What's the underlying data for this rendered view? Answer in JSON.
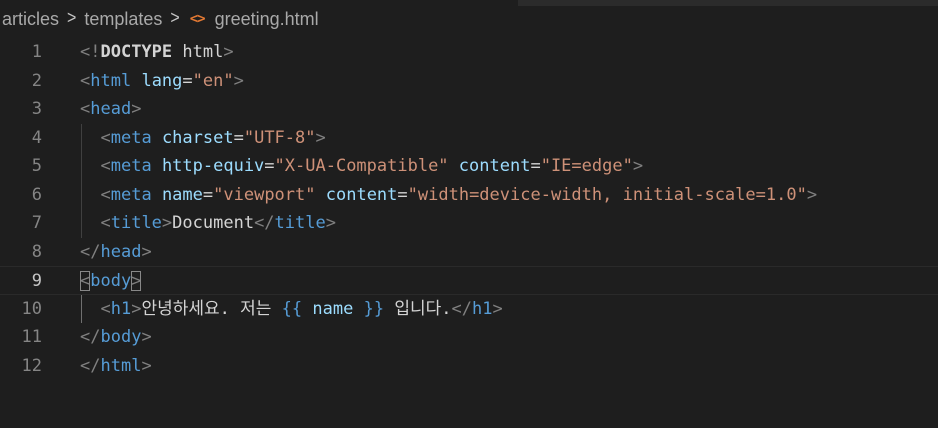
{
  "breadcrumb": {
    "items": [
      "articles",
      "templates",
      "greeting.html"
    ],
    "separator": ">",
    "file_icon": "<>"
  },
  "editor": {
    "current_line": 9,
    "lines": [
      {
        "number": "1",
        "indent": 0,
        "tokens": [
          [
            "punc",
            "<!"
          ],
          [
            "bold",
            "DOCTYPE"
          ],
          [
            "text",
            " html"
          ],
          [
            "punc",
            ">"
          ]
        ]
      },
      {
        "number": "2",
        "indent": 0,
        "tokens": [
          [
            "punc",
            "<"
          ],
          [
            "tag",
            "html"
          ],
          [
            "text",
            " "
          ],
          [
            "attr",
            "lang"
          ],
          [
            "text",
            "="
          ],
          [
            "str",
            "\"en\""
          ],
          [
            "punc",
            ">"
          ]
        ]
      },
      {
        "number": "3",
        "indent": 0,
        "tokens": [
          [
            "punc",
            "<"
          ],
          [
            "tag",
            "head"
          ],
          [
            "punc",
            ">"
          ]
        ]
      },
      {
        "number": "4",
        "indent": 1,
        "tokens": [
          [
            "text",
            "  "
          ],
          [
            "punc",
            "<"
          ],
          [
            "tag",
            "meta"
          ],
          [
            "text",
            " "
          ],
          [
            "attr",
            "charset"
          ],
          [
            "text",
            "="
          ],
          [
            "str",
            "\"UTF-8\""
          ],
          [
            "punc",
            ">"
          ]
        ]
      },
      {
        "number": "5",
        "indent": 1,
        "tokens": [
          [
            "text",
            "  "
          ],
          [
            "punc",
            "<"
          ],
          [
            "tag",
            "meta"
          ],
          [
            "text",
            " "
          ],
          [
            "attr",
            "http-equiv"
          ],
          [
            "text",
            "="
          ],
          [
            "str",
            "\"X-UA-Compatible\""
          ],
          [
            "text",
            " "
          ],
          [
            "attr",
            "content"
          ],
          [
            "text",
            "="
          ],
          [
            "str",
            "\"IE=edge\""
          ],
          [
            "punc",
            ">"
          ]
        ]
      },
      {
        "number": "6",
        "indent": 1,
        "tokens": [
          [
            "text",
            "  "
          ],
          [
            "punc",
            "<"
          ],
          [
            "tag",
            "meta"
          ],
          [
            "text",
            " "
          ],
          [
            "attr",
            "name"
          ],
          [
            "text",
            "="
          ],
          [
            "str",
            "\"viewport\""
          ],
          [
            "text",
            " "
          ],
          [
            "attr",
            "content"
          ],
          [
            "text",
            "="
          ],
          [
            "str",
            "\"width=device-width, initial-scale=1.0\""
          ],
          [
            "punc",
            ">"
          ]
        ]
      },
      {
        "number": "7",
        "indent": 1,
        "tokens": [
          [
            "text",
            "  "
          ],
          [
            "punc",
            "<"
          ],
          [
            "tag",
            "title"
          ],
          [
            "punc",
            ">"
          ],
          [
            "text",
            "Document"
          ],
          [
            "punc",
            "</"
          ],
          [
            "tag",
            "title"
          ],
          [
            "punc",
            ">"
          ]
        ]
      },
      {
        "number": "8",
        "indent": 0,
        "tokens": [
          [
            "punc",
            "</"
          ],
          [
            "tag",
            "head"
          ],
          [
            "punc",
            ">"
          ]
        ]
      },
      {
        "number": "9",
        "indent": 0,
        "tokens": [
          [
            "punchl",
            "<"
          ],
          [
            "tag",
            "body"
          ],
          [
            "punchl",
            ">"
          ]
        ]
      },
      {
        "number": "10",
        "indent": 1,
        "tokens": [
          [
            "text",
            "  "
          ],
          [
            "punc",
            "<"
          ],
          [
            "tag",
            "h1"
          ],
          [
            "punc",
            ">"
          ],
          [
            "text",
            "안녕하세요. 저는 "
          ],
          [
            "tmpl",
            "{{"
          ],
          [
            "text",
            " "
          ],
          [
            "tvar",
            "name"
          ],
          [
            "text",
            " "
          ],
          [
            "tmpl",
            "}}"
          ],
          [
            "text",
            " 입니다."
          ],
          [
            "punc",
            "</"
          ],
          [
            "tag",
            "h1"
          ],
          [
            "punc",
            ">"
          ]
        ]
      },
      {
        "number": "11",
        "indent": 0,
        "tokens": [
          [
            "punc",
            "</"
          ],
          [
            "tag",
            "body"
          ],
          [
            "punc",
            ">"
          ]
        ]
      },
      {
        "number": "12",
        "indent": 0,
        "tokens": [
          [
            "punc",
            "</"
          ],
          [
            "tag",
            "html"
          ],
          [
            "punc",
            ">"
          ]
        ]
      }
    ]
  },
  "icons": {
    "file_icon": "html-file-icon",
    "separator": "chevron-right-icon"
  }
}
